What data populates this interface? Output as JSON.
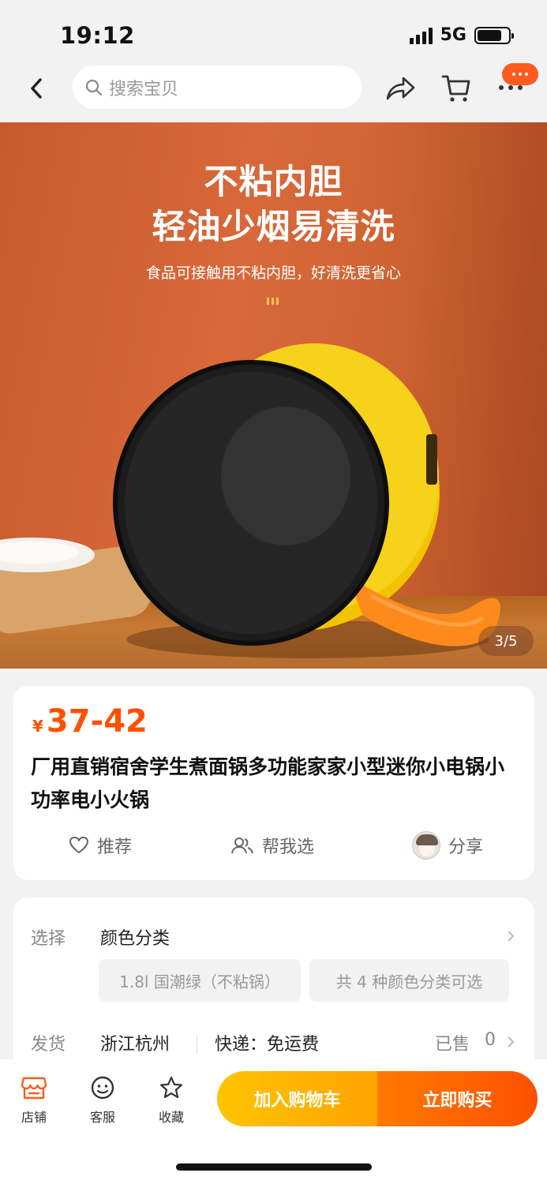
{
  "status_bar": {
    "time": "19:12",
    "network": "5G"
  },
  "search": {
    "placeholder": "搜索宝贝"
  },
  "hero": {
    "title_line1": "不粘内胆",
    "title_line2": "轻油少烟易清洗",
    "subtitle": "食品可接触用不粘内胆，好清洗更省心",
    "page_indicator": "3/5"
  },
  "product": {
    "currency": "¥",
    "price_range": "37-42",
    "title": "厂用直销宿舍学生煮面锅多功能家家小型迷你小电锅小功率电小火锅",
    "actions": {
      "recommend": "推荐",
      "help_choose": "帮我选",
      "share": "分享"
    }
  },
  "spec": {
    "select_label": "选择",
    "select_value": "颜色分类",
    "chip_selected": "1.8l 国潮绿（不粘锅）",
    "chip_count": "共 4 种颜色分类可选",
    "ship_label": "发货",
    "ship_from": "浙江杭州",
    "express": "快递：免运费",
    "sold_label": "已售",
    "sold_count": "0"
  },
  "bottom_bar": {
    "shop": "店铺",
    "service": "客服",
    "favorite": "收藏",
    "add_to_cart": "加入购物车",
    "buy_now": "立即购买"
  },
  "icons": {
    "back": "chevron-left-icon",
    "search": "search-icon",
    "share": "share-arrow-icon",
    "cart": "cart-icon",
    "more": "more-icon",
    "recommend": "heart-icon",
    "help_choose": "people-icon",
    "shop": "shop-icon",
    "service": "service-face-icon",
    "favorite": "star-icon"
  },
  "colors": {
    "accent": "#ff5000",
    "cart_button": "#ffb000",
    "hero_background": "#cf6332"
  }
}
